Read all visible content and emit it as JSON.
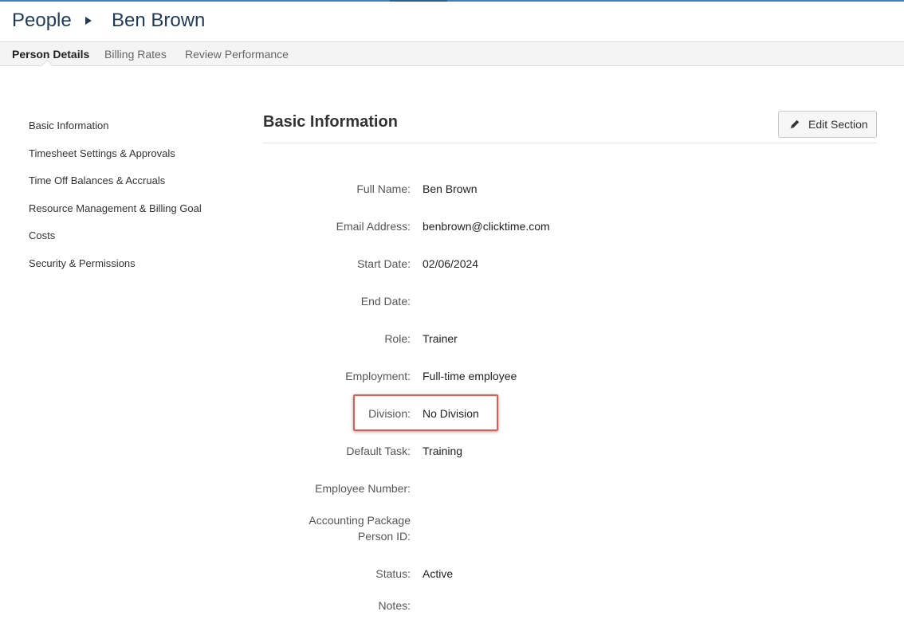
{
  "breadcrumb": {
    "root": "People",
    "current": "Ben Brown"
  },
  "tabs": [
    {
      "label": "Person Details",
      "active": true
    },
    {
      "label": "Billing Rates",
      "active": false
    },
    {
      "label": "Review Performance",
      "active": false
    }
  ],
  "sidenav": {
    "items": [
      "Basic Information",
      "Timesheet Settings & Approvals",
      "Time Off Balances & Accruals",
      "Resource Management & Billing Goal",
      "Costs",
      "Security & Permissions"
    ]
  },
  "section": {
    "title": "Basic Information",
    "edit_label": "Edit Section",
    "edit_icon": "pencil-icon"
  },
  "fields": {
    "full_name": {
      "label": "Full Name:",
      "value": "Ben Brown"
    },
    "email": {
      "label": "Email Address:",
      "value": "benbrown@clicktime.com"
    },
    "start_date": {
      "label": "Start Date:",
      "value": "02/06/2024"
    },
    "end_date": {
      "label": "End Date:",
      "value": ""
    },
    "role": {
      "label": "Role:",
      "value": "Trainer"
    },
    "employment": {
      "label": "Employment:",
      "value": "Full-time employee"
    },
    "division": {
      "label": "Division:",
      "value": "No Division"
    },
    "default_task": {
      "label": "Default Task:",
      "value": "Training"
    },
    "employee_number": {
      "label": "Employee Number:",
      "value": ""
    },
    "accounting_id": {
      "label_line1": "Accounting Package",
      "label_line2": "Person ID:",
      "value": ""
    },
    "status": {
      "label": "Status:",
      "value": "Active"
    },
    "notes": {
      "label": "Notes:",
      "value": ""
    }
  },
  "colors": {
    "accent": "#3b7fc4",
    "highlight": "#e35a4f",
    "heading": "#1f3b57"
  }
}
